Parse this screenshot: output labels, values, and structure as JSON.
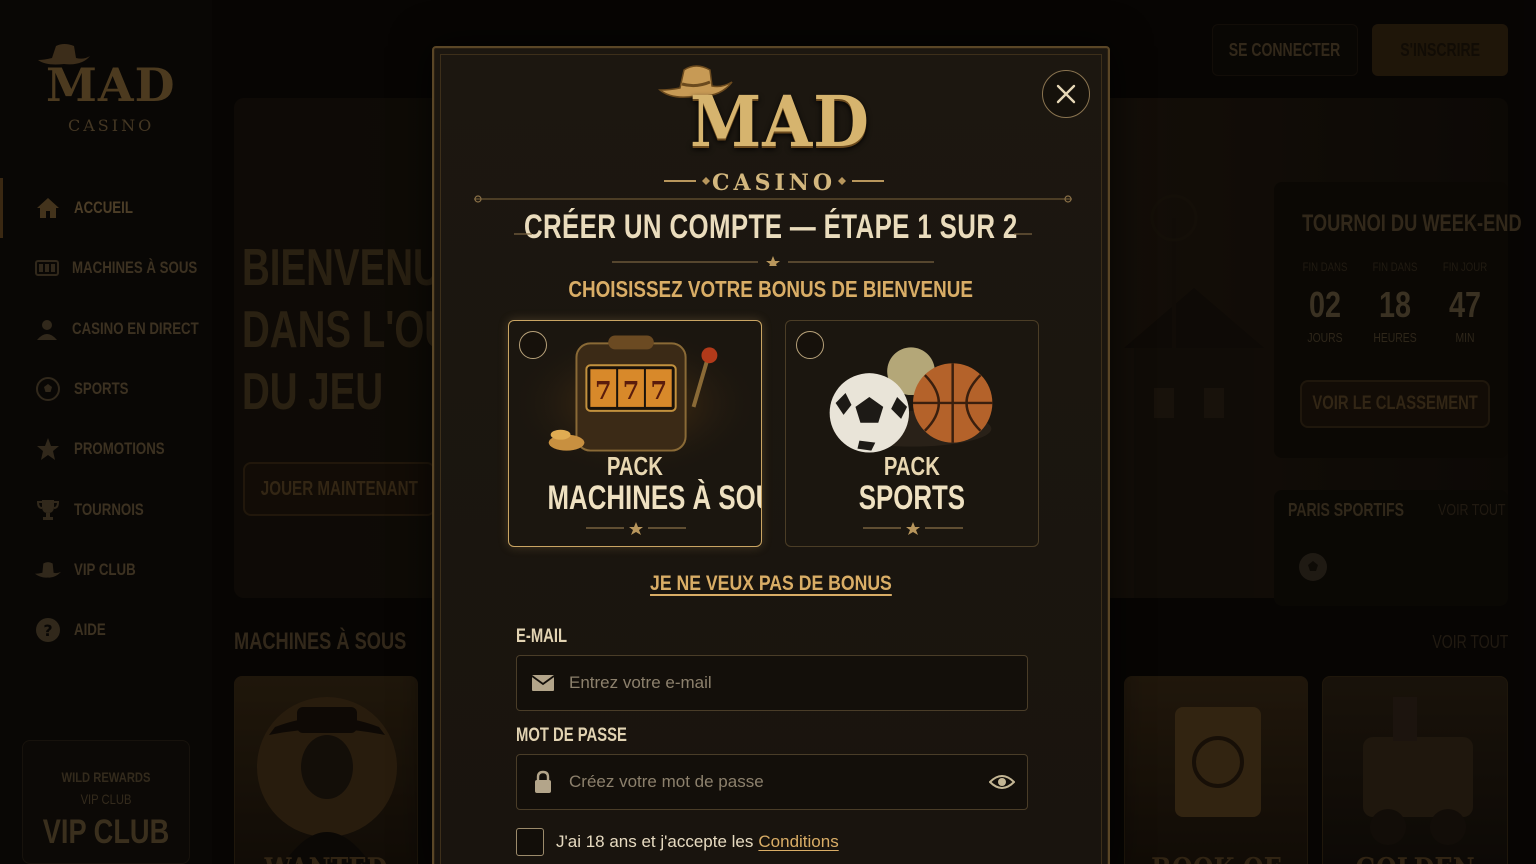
{
  "brand": {
    "name": "MAD",
    "sub": "CASINO"
  },
  "header": {
    "login": "SE CONNECTER",
    "signup": "S'INSCRIRE"
  },
  "sidebar": {
    "items": [
      {
        "label": "ACCUEIL",
        "icon": "home-icon",
        "active": true
      },
      {
        "label": "MACHINES À SOUS",
        "icon": "slot-machine-icon"
      },
      {
        "label": "CASINO EN DIRECT",
        "icon": "dealer-icon"
      },
      {
        "label": "SPORTS",
        "icon": "soccer-ball-icon"
      },
      {
        "label": "PROMOTIONS",
        "icon": "star-icon"
      },
      {
        "label": "TOURNOIS",
        "icon": "trophy-icon"
      },
      {
        "label": "VIP CLUB",
        "icon": "cowboy-hat-icon"
      },
      {
        "label": "AIDE",
        "icon": "help-icon"
      }
    ],
    "vip": {
      "line1": "WILD REWARDS",
      "line2": "VIP CLUB",
      "big": "VIP CLUB"
    }
  },
  "hero": {
    "line1": "BIENVENUE",
    "line2": "DANS L'OUEST",
    "line3": "DU JEU",
    "cta": "JOUER MAINTENANT"
  },
  "tournament": {
    "title": "TOURNOI DU WEEK-END",
    "labels": [
      "FIN DANS",
      "FIN DANS",
      "FIN JOUR"
    ],
    "values": [
      "02",
      "18",
      "47"
    ],
    "units": [
      "JOURS",
      "HEURES",
      "MIN"
    ],
    "cta": "VOIR LE CLASSEMENT"
  },
  "sports_box": {
    "title": "PARIS SPORTIFS",
    "all": "VOIR TOUT"
  },
  "slots_section": {
    "title": "MACHINES À SOUS",
    "all": "VOIR TOUT"
  },
  "games": [
    "WANTED",
    "BOOK OF",
    "GOLDEN"
  ],
  "modal": {
    "title": "CRÉER UN COMPTE — ÉTAPE 1 SUR 2",
    "subtitle": "CHOISISSEZ VOTRE BONUS DE BIENVENUE",
    "bonuses": [
      {
        "pack": "PACK",
        "name": "MACHINES À SOUS",
        "selected": true
      },
      {
        "pack": "PACK",
        "name": "SPORTS",
        "selected": false
      }
    ],
    "no_bonus": "JE NE VEUX PAS DE BONUS",
    "email": {
      "label": "E-MAIL",
      "placeholder": "Entrez votre e-mail",
      "value": ""
    },
    "password": {
      "label": "MOT DE PASSE",
      "placeholder": "Créez votre mot de passe",
      "value": ""
    },
    "terms": {
      "text": "J'ai 18 ans et j'accepte les",
      "link": "Conditions",
      "checked": false
    }
  },
  "colors": {
    "gold": "#d9ad66",
    "cream": "#eadcbd",
    "bg": "#0d0a07"
  }
}
